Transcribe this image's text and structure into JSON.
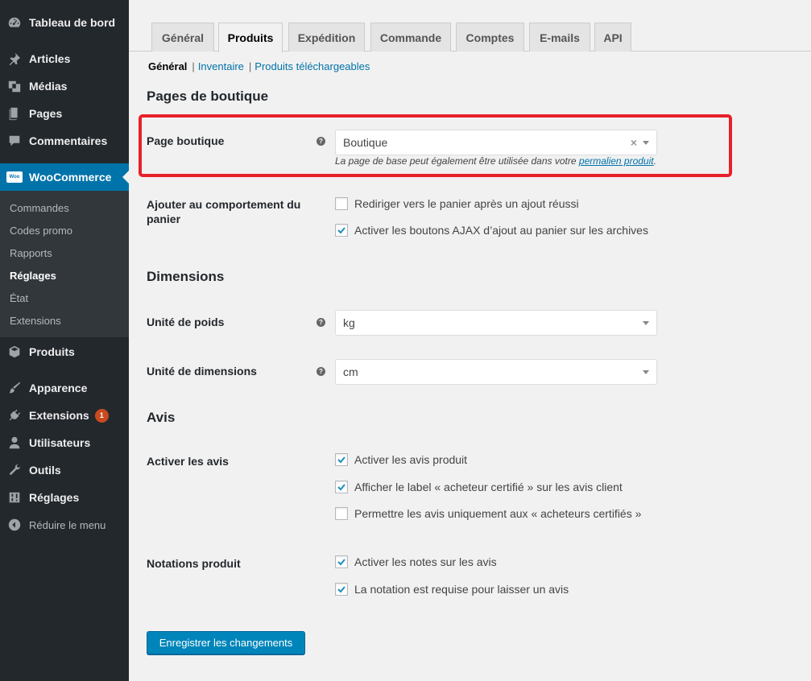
{
  "sidebar": {
    "dashboard": "Tableau de bord",
    "articles": "Articles",
    "medias": "Médias",
    "pages": "Pages",
    "comments": "Commentaires",
    "woocommerce": "WooCommerce",
    "woo_logo": "Woo",
    "submenu": {
      "orders": "Commandes",
      "coupons": "Codes promo",
      "reports": "Rapports",
      "settings": "Réglages",
      "status": "État",
      "extensions": "Extensions"
    },
    "products": "Produits",
    "appearance": "Apparence",
    "plugins": "Extensions",
    "plugins_badge": "1",
    "users": "Utilisateurs",
    "tools": "Outils",
    "settings": "Réglages",
    "collapse": "Réduire le menu"
  },
  "tabs": [
    "Général",
    "Produits",
    "Expédition",
    "Commande",
    "Comptes",
    "E-mails",
    "API"
  ],
  "subnav": {
    "general": "Général",
    "inventory": "Inventaire",
    "downloadable": "Produits téléchargeables",
    "separator": "|"
  },
  "shop_pages": {
    "title": "Pages de boutique",
    "shop_page_label": "Page boutique",
    "shop_page_value": "Boutique",
    "clear_glyph": "×",
    "description_prefix": "La page de base peut également être utilisée dans votre ",
    "description_link": "permalien produit",
    "description_suffix": ".",
    "cart_behavior_label": "Ajouter au comportement du panier",
    "redirect_cart": "Rediriger vers le panier après un ajout réussi",
    "ajax_buttons": "Activer les boutons AJAX d’ajout au panier sur les archives"
  },
  "dimensions": {
    "title": "Dimensions",
    "weight_label": "Unité de poids",
    "weight_value": "kg",
    "dim_label": "Unité de dimensions",
    "dim_value": "cm"
  },
  "reviews": {
    "title": "Avis",
    "enable_label": "Activer les avis",
    "enable_product_reviews": "Activer les avis produit",
    "verified_label": "Afficher le label « acheteur certifié » sur les avis client",
    "verified_only": "Permettre les avis uniquement aux « acheteurs certifiés »",
    "ratings_label": "Notations produit",
    "enable_ratings": "Activer les notes sur les avis",
    "rating_required": "La notation est requise pour laisser un avis"
  },
  "help_glyph": "?",
  "save_button": "Enregistrer les changements",
  "colors": {
    "sidebar": "#23282d",
    "accent": "#0073aa",
    "highlight": "#e8202a",
    "button": "#0085ba"
  }
}
